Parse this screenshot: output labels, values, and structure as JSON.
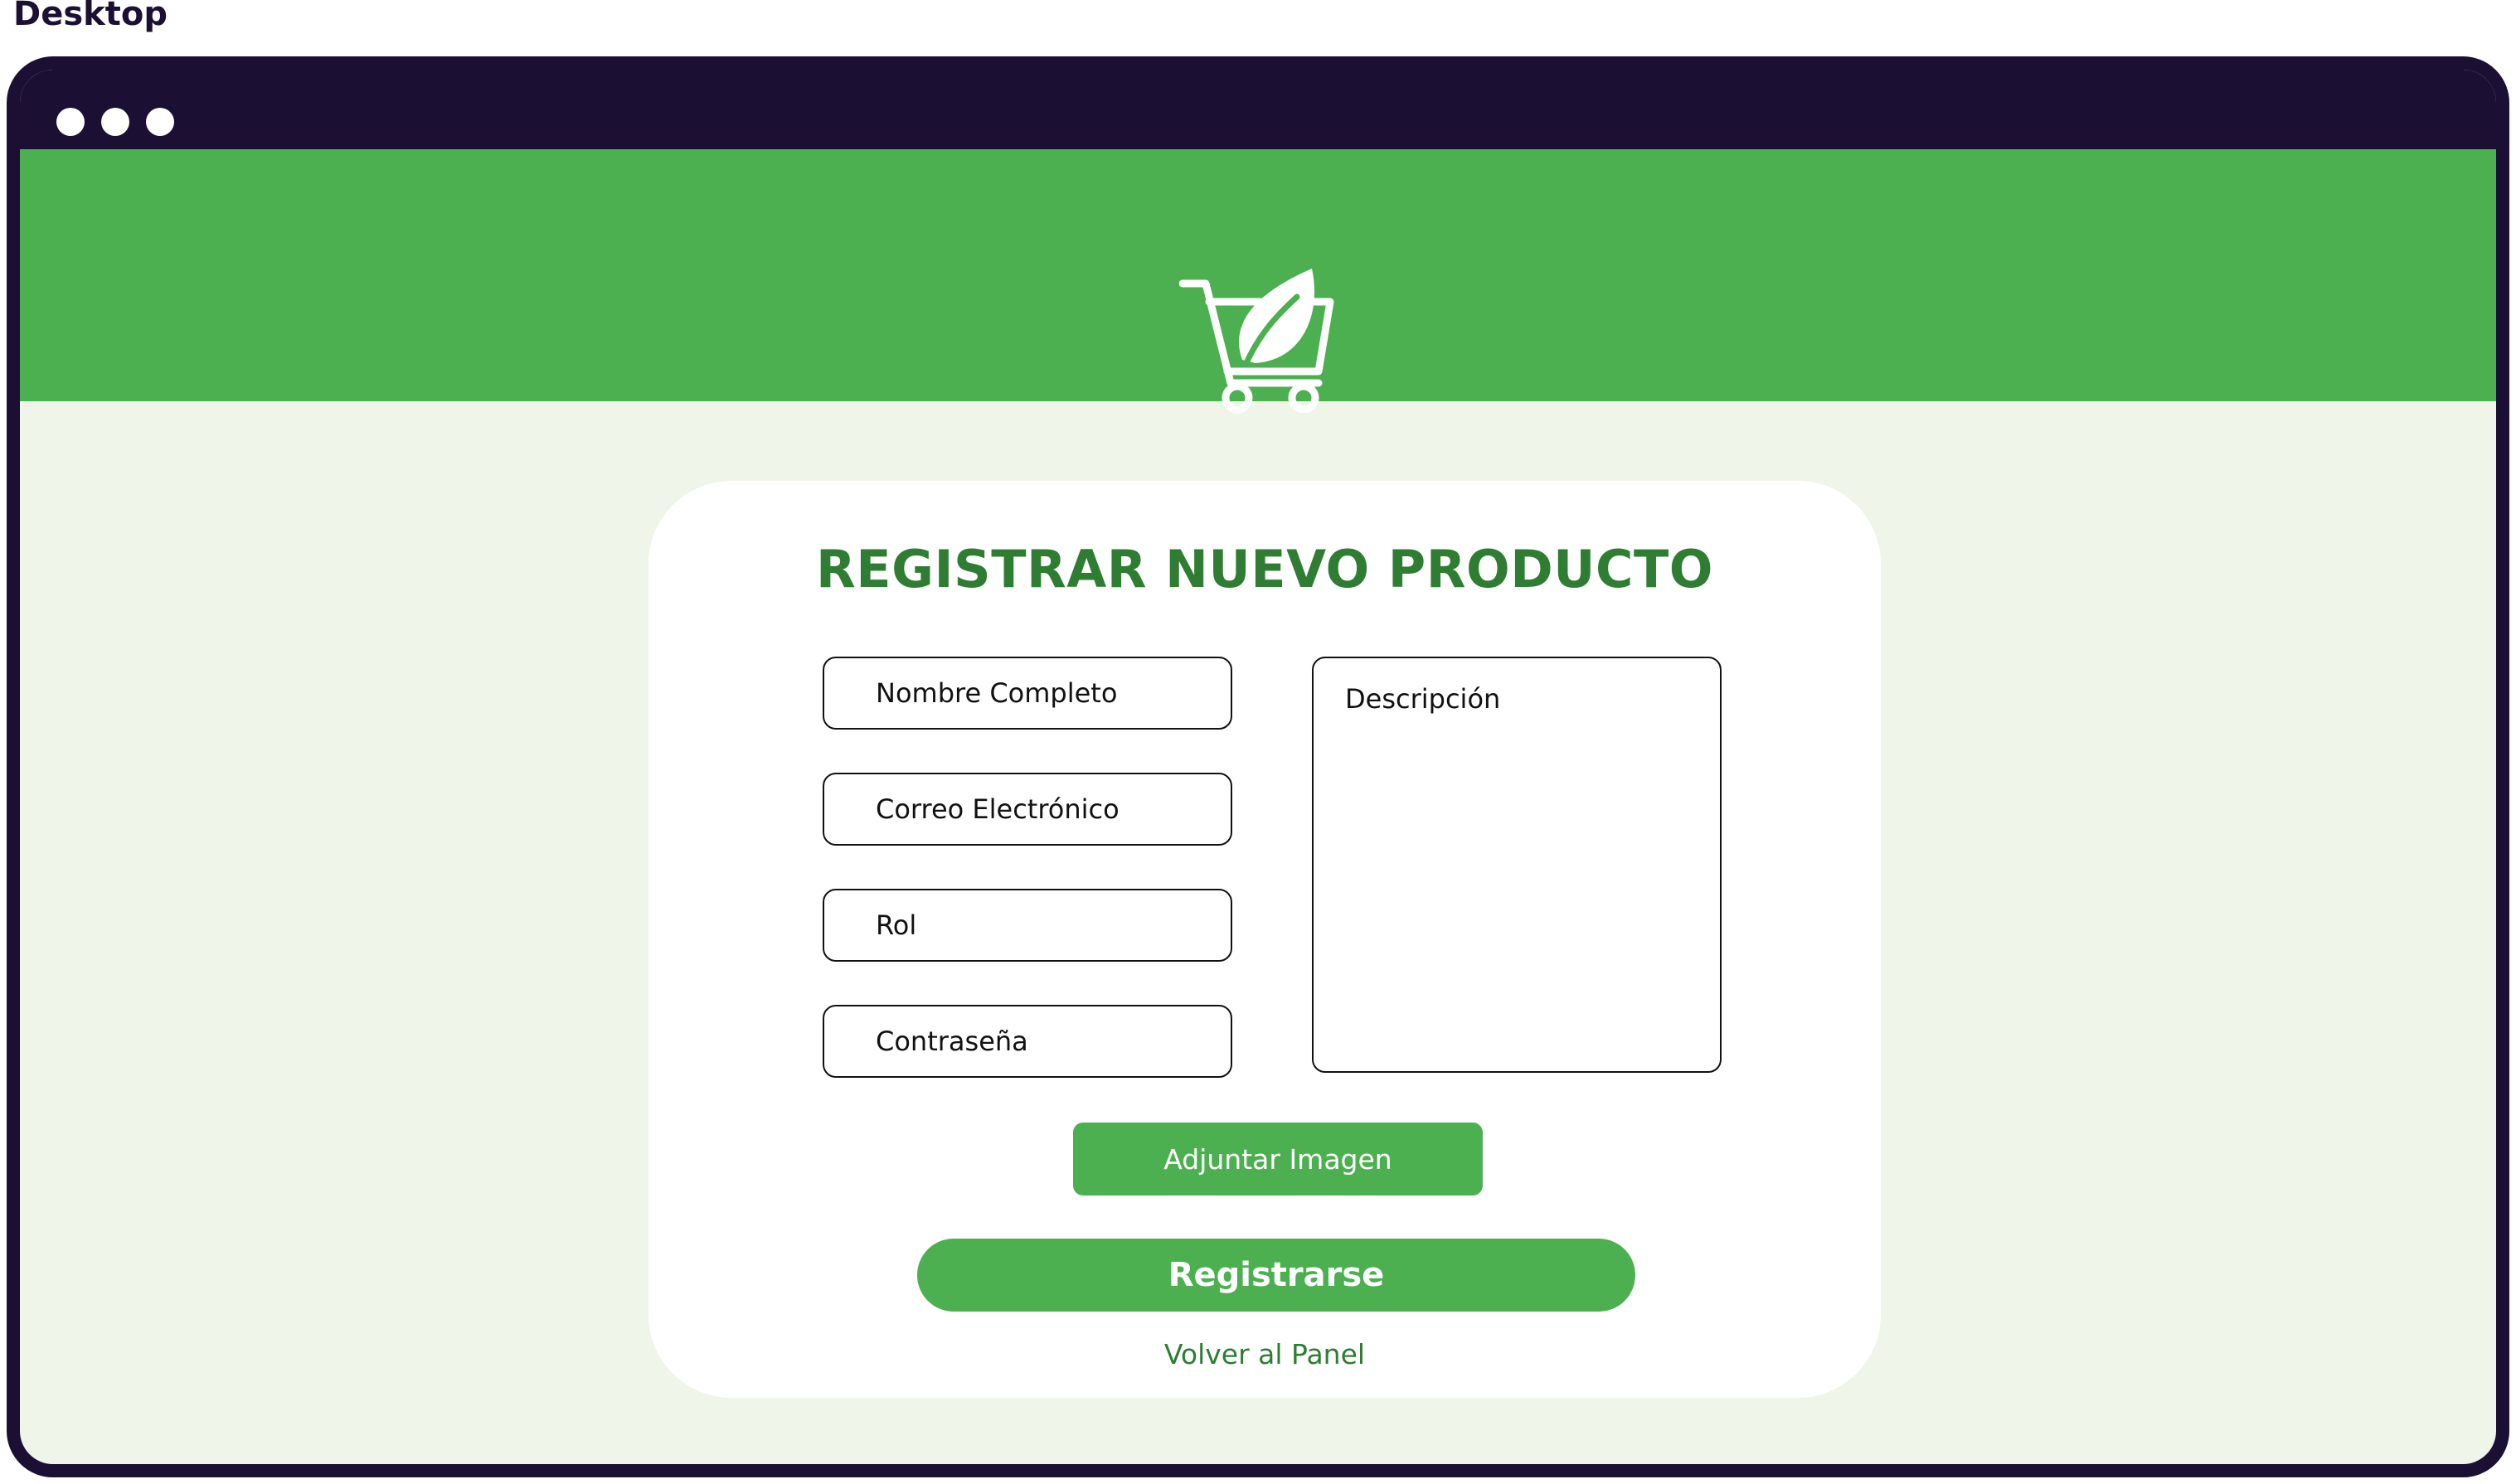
{
  "frame": {
    "label": "Desktop"
  },
  "colors": {
    "brand": "#4caf50",
    "brand_dark": "#2e7d32",
    "window_chrome": "#1b1034",
    "page_bg": "#eff5e8"
  },
  "header": {
    "logo_icon": "shopping-cart-leaf-icon"
  },
  "form": {
    "title": "REGISTRAR NUEVO PRODUCTO",
    "fields": {
      "name_placeholder": "Nombre Completo",
      "email_placeholder": "Correo Electrónico",
      "role_placeholder": "Rol",
      "password_placeholder": "Contraseña",
      "description_placeholder": "Descripción"
    },
    "attach_label": "Adjuntar Imagen",
    "submit_label": "Registrarse",
    "back_label": "Volver al Panel"
  }
}
